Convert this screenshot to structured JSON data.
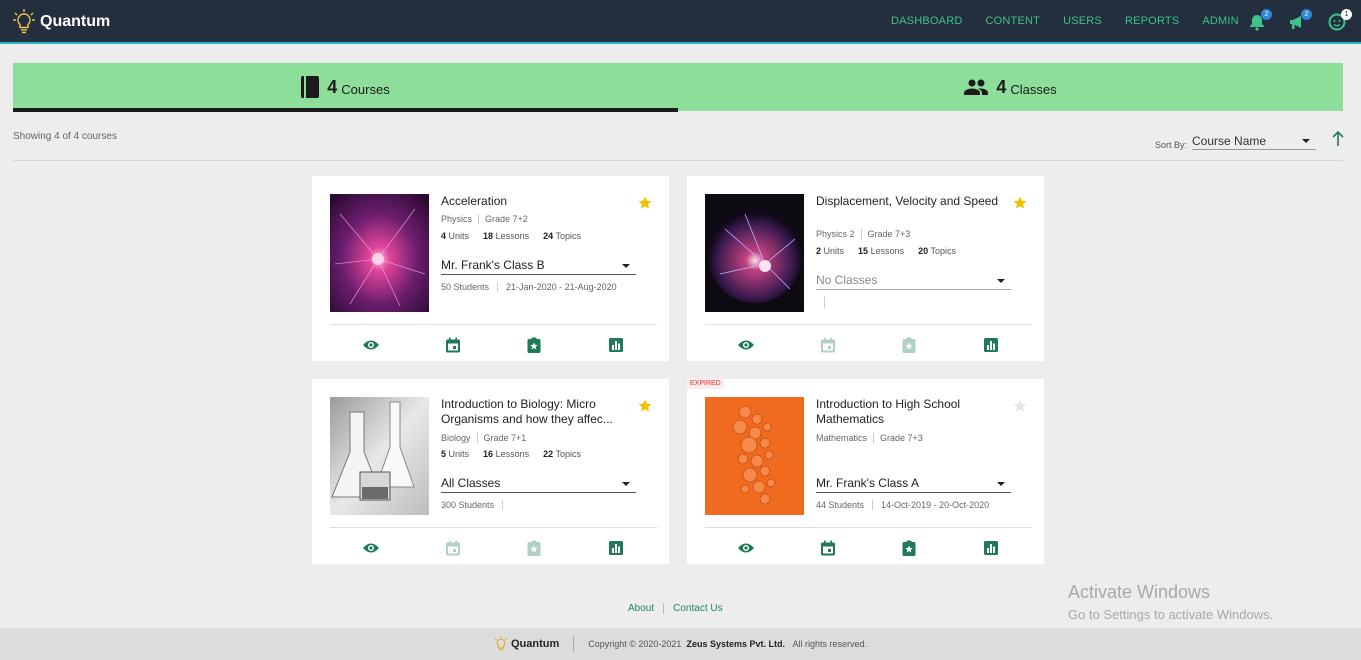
{
  "app": {
    "name": "Quantum"
  },
  "nav": {
    "items": [
      "DASHBOARD",
      "CONTENT",
      "USERS",
      "REPORTS",
      "ADMIN"
    ],
    "icons": [
      {
        "name": "notification-bell-icon",
        "badge": "2"
      },
      {
        "name": "announcement-megaphone-icon",
        "badge": "2"
      },
      {
        "name": "profile-icon",
        "badge": "1"
      }
    ]
  },
  "tabs": [
    {
      "count": "4",
      "label": "Courses",
      "icon": "book-icon",
      "active": true
    },
    {
      "count": "4",
      "label": "Classes",
      "icon": "group-icon",
      "active": false
    }
  ],
  "list": {
    "showing": "Showing 4 of 4 courses",
    "sort_label": "Sort By:",
    "sort_value": "Course Name"
  },
  "courses": [
    {
      "title": "Acceleration",
      "subject": "Physics",
      "grade": "Grade 7+2",
      "units": "4",
      "lessons": "18",
      "topics": "24",
      "units_label": "Units",
      "lessons_label": "Lessons",
      "topics_label": "Topics",
      "class_select": "Mr. Frank's Class B",
      "students": "50 Students",
      "dates": "21-Jan-2020 - 21-Aug-2020",
      "starred": true
    },
    {
      "title": "Displacement, Velocity and Speed",
      "subject": "Physics 2",
      "grade": "Grade 7+3",
      "units": "2",
      "lessons": "15",
      "topics": "20",
      "units_label": "Units",
      "lessons_label": "Lessons",
      "topics_label": "Topics",
      "class_select": "No Classes",
      "students": "",
      "dates": "",
      "starred": true
    },
    {
      "title": "Introduction to Biology: Micro Organisms and how they affec...",
      "subject": "Biology",
      "grade": "Grade 7+1",
      "units": "5",
      "lessons": "16",
      "topics": "22",
      "units_label": "Units",
      "lessons_label": "Lessons",
      "topics_label": "Topics",
      "class_select": "All Classes",
      "students": "300 Students",
      "dates": "",
      "starred": true
    },
    {
      "title": "Introduction to High School Mathematics",
      "subject": "Mathematics",
      "grade": "Grade 7+3",
      "class_select": "Mr. Frank's Class A",
      "students": "44 Students",
      "dates": "14-Oct-2019 - 20-Oct-2020",
      "starred": false,
      "badge": "EXPIRED"
    }
  ],
  "footer": {
    "links": [
      "About",
      "Contact Us"
    ],
    "brand": "Quantum",
    "copyright": "Copyright © 2020-2021",
    "company": "Zeus Systems Pvt. Ltd.",
    "rights": "All rights reserved."
  },
  "watermark": {
    "title": "Activate Windows",
    "subtitle": "Go to Settings to activate Windows."
  },
  "colors": {
    "nav_bg": "#232f3e",
    "accent": "#3ec18b",
    "tab_bg": "#8dde9a",
    "action": "#1f7a55",
    "star": "#f2c200"
  }
}
